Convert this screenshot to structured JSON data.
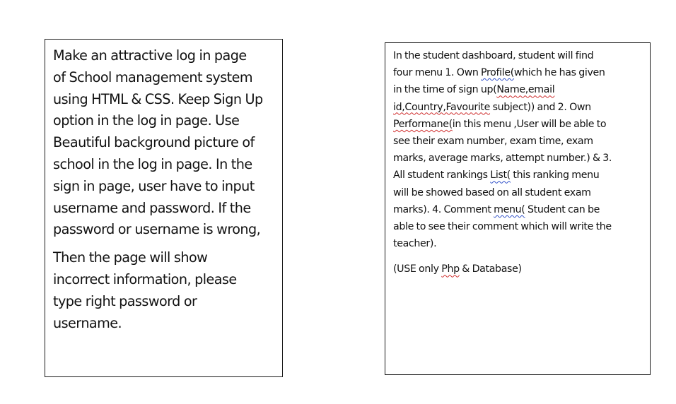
{
  "left_box": {
    "paragraphs": [
      {
        "lines": [
          "Make an attractive log in page",
          "of School management system",
          "using HTML & CSS. Keep Sign Up",
          "option in the log in page. Use",
          "Beautiful background picture of",
          "school in the log in page. In the",
          "sign in page, user have to input",
          "username and password. If the",
          "password or username is wrong,"
        ]
      },
      {
        "lines": [
          "Then the page will show",
          "incorrect information, please",
          "type right password or",
          "username."
        ]
      }
    ]
  },
  "right_box": {
    "paragraph1": {
      "l1": "In the student dashboard, student will find",
      "l2_a": "four menu 1. Own ",
      "l2_b": "Profile(",
      "l2_c": "which he has given",
      "l3_a": "in the time of sign up(",
      "l3_b": "Name,email",
      "l4_a": "id,Country,Favourite",
      "l4_b": " subject)) and 2. Own",
      "l5_a": "Performane(",
      "l5_b": "in this menu ,User will be able to",
      "l6": "see their exam number, exam time, exam",
      "l7": "marks, average marks, attempt number.) & 3.",
      "l8_a": "All student rankings ",
      "l8_b": "List(",
      "l8_c": " this ranking menu",
      "l9": "will be showed based on all student exam",
      "l10_a": "marks). 4. Comment ",
      "l10_b": "menu(",
      "l10_c": " Student can be",
      "l11": "able to see their comment which will write the",
      "l12": "teacher)."
    },
    "paragraph2": {
      "a": "(USE only ",
      "b": "Php",
      "c": " & Database)"
    }
  },
  "colors": {
    "spellcheck_red": "#d03030",
    "grammar_blue": "#3050c8",
    "border": "#1a1a1a"
  }
}
